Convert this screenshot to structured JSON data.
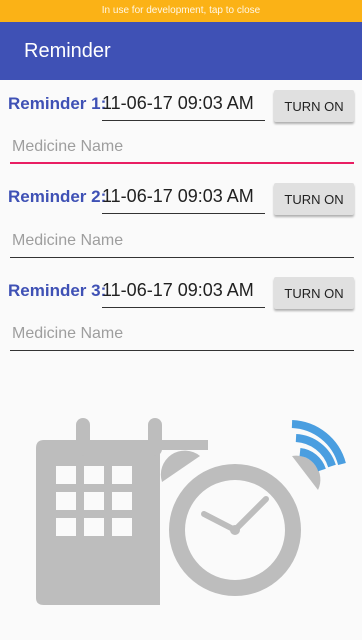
{
  "status_bar": {
    "text": "In use for development, tap to close"
  },
  "app_bar": {
    "title": "Reminder"
  },
  "reminders": [
    {
      "label": "Reminder 1:",
      "datetime": "11-06-17 09:03 AM",
      "button": "TURN ON",
      "medicine_placeholder": "Medicine Name"
    },
    {
      "label": "Reminder 2:",
      "datetime": "11-06-17 09:03 AM",
      "button": "TURN ON",
      "medicine_placeholder": "Medicine Name"
    },
    {
      "label": "Reminder 3:",
      "datetime": "11-06-17 09:03 AM",
      "button": "TURN ON",
      "medicine_placeholder": "Medicine Name"
    }
  ],
  "illustration": {
    "icons": [
      "calendar-icon",
      "alarm-clock-icon",
      "wifi-signal-icon"
    ]
  },
  "colors": {
    "primary": "#3f51b5",
    "accent": "#e91e63",
    "status": "#fbb216",
    "icon_gray": "#bdbdbd",
    "signal_blue": "#4a9ee0"
  }
}
